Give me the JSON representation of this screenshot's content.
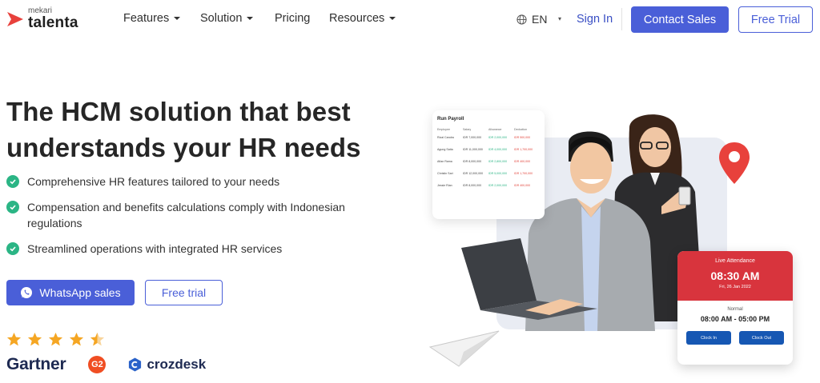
{
  "brand": {
    "small": "mekari",
    "name": "talenta",
    "color": "#e8413c"
  },
  "nav": {
    "items": [
      {
        "label": "Features",
        "has_dropdown": true
      },
      {
        "label": "Solution",
        "has_dropdown": true
      },
      {
        "label": "Pricing",
        "has_dropdown": false
      },
      {
        "label": "Resources",
        "has_dropdown": true
      }
    ],
    "language": "EN",
    "language_icon": "globe-icon",
    "sign_in": "Sign In",
    "contact_sales": "Contact Sales",
    "free_trial": "Free Trial"
  },
  "hero": {
    "title": "The HCM solution that best understands your HR needs",
    "features": [
      "Comprehensive HR features tailored to your needs",
      "Compensation and benefits calculations comply with Indonesian regulations",
      "Streamlined operations with integrated HR services"
    ],
    "cta_primary": "WhatsApp sales",
    "cta_secondary": "Free trial",
    "rating_stars": 4.5,
    "review_brands": [
      "Gartner",
      "G2",
      "crozdesk"
    ]
  },
  "illustration": {
    "payroll": {
      "title": "Run Payroll",
      "columns": [
        "Employee",
        "Salary",
        "Allowance",
        "Deduction"
      ],
      "rows": [
        [
          "Rizal Candra",
          "IDR 7,000,000",
          "IDR 2,000,000",
          "IDR 500,000"
        ],
        [
          "Agung Satia",
          "IDR 11,000,000",
          "IDR 4,000,000",
          "IDR 1,700,000"
        ],
        [
          "Afian Rama",
          "IDR 8,000,000",
          "IDR 2,800,000",
          "IDR 400,000"
        ],
        [
          "Christin Sari",
          "IDR 12,000,000",
          "IDR 5,000,000",
          "IDR 1,700,000"
        ],
        [
          "Jessie Rian",
          "IDR 8,000,000",
          "IDR 2,000,000",
          "IDR 400,000"
        ]
      ]
    },
    "attendance": {
      "label": "Live Attendance",
      "time": "08:30 AM",
      "date": "Fri, 26 Jan 2022",
      "shift_label": "Normal",
      "shift_range": "08:00 AM - 05:00 PM",
      "clock_in": "Clock In",
      "clock_out": "Clock Out"
    }
  },
  "colors": {
    "primary": "#4a5fd8",
    "check": "#2bb585",
    "star": "#f5a623",
    "attendance_red": "#d8343d",
    "button_blue": "#1657b3"
  }
}
